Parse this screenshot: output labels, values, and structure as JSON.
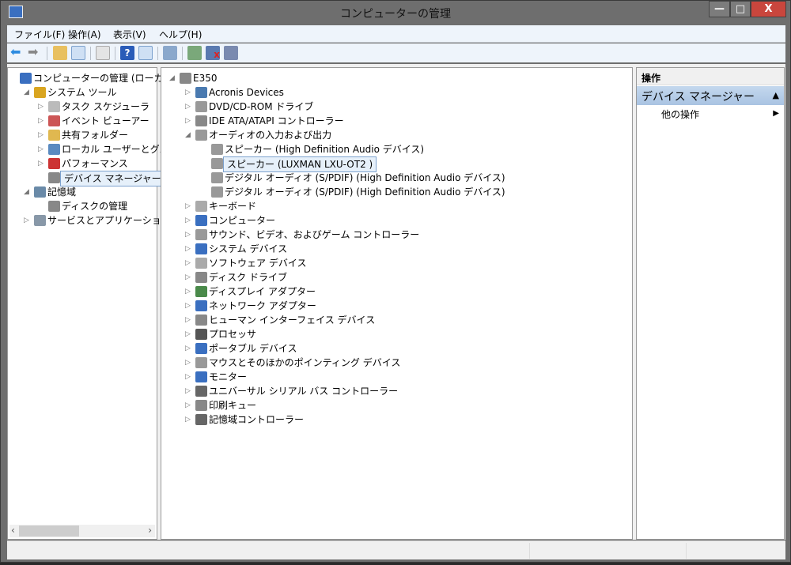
{
  "window": {
    "title": "コンピューターの管理",
    "min": "—",
    "max": "□",
    "close": "X"
  },
  "menu": [
    "ファイル(F)",
    "操作(A)",
    "表示(V)",
    "ヘルプ(H)"
  ],
  "left_tree": [
    {
      "label": "コンピューターの管理 (ローカル)",
      "level": 0,
      "exp": "",
      "color": "#3a6fc0"
    },
    {
      "label": "システム ツール",
      "level": 1,
      "exp": "◢",
      "color": "#d9a520"
    },
    {
      "label": "タスク スケジューラ",
      "level": 2,
      "exp": "▷",
      "color": "#bbb"
    },
    {
      "label": "イベント ビューアー",
      "level": 2,
      "exp": "▷",
      "color": "#c55"
    },
    {
      "label": "共有フォルダー",
      "level": 2,
      "exp": "▷",
      "color": "#e0b850"
    },
    {
      "label": "ローカル ユーザーとグループ",
      "level": 2,
      "exp": "▷",
      "color": "#5a8ac0"
    },
    {
      "label": "パフォーマンス",
      "level": 2,
      "exp": "▷",
      "color": "#c33"
    },
    {
      "label": "デバイス マネージャー",
      "level": 2,
      "exp": "",
      "color": "#888",
      "selected": true
    },
    {
      "label": "記憶域",
      "level": 1,
      "exp": "◢",
      "color": "#6a8aa8"
    },
    {
      "label": "ディスクの管理",
      "level": 2,
      "exp": "",
      "color": "#888"
    },
    {
      "label": "サービスとアプリケーション",
      "level": 1,
      "exp": "▷",
      "color": "#8898a8"
    }
  ],
  "device_tree": [
    {
      "label": "E350",
      "level": 0,
      "exp": "◢",
      "color": "#888"
    },
    {
      "label": "Acronis Devices",
      "level": 1,
      "exp": "▷",
      "color": "#4a7ab0"
    },
    {
      "label": "DVD/CD-ROM ドライブ",
      "level": 1,
      "exp": "▷",
      "color": "#999"
    },
    {
      "label": "IDE ATA/ATAPI コントローラー",
      "level": 1,
      "exp": "▷",
      "color": "#888"
    },
    {
      "label": "オーディオの入力および出力",
      "level": 1,
      "exp": "◢",
      "color": "#999"
    },
    {
      "label": "スピーカー (High Definition Audio デバイス)",
      "level": 2,
      "exp": "",
      "color": "#999"
    },
    {
      "label": "スピーカー (LUXMAN LXU-OT2  )",
      "level": 2,
      "exp": "",
      "color": "#999",
      "selected": true
    },
    {
      "label": "デジタル オーディオ (S/PDIF) (High Definition Audio デバイス)",
      "level": 2,
      "exp": "",
      "color": "#999"
    },
    {
      "label": "デジタル オーディオ (S/PDIF) (High Definition Audio デバイス)",
      "level": 2,
      "exp": "",
      "color": "#999"
    },
    {
      "label": "キーボード",
      "level": 1,
      "exp": "▷",
      "color": "#aaa"
    },
    {
      "label": "コンピューター",
      "level": 1,
      "exp": "▷",
      "color": "#3a6fc0"
    },
    {
      "label": "サウンド、ビデオ、およびゲーム コントローラー",
      "level": 1,
      "exp": "▷",
      "color": "#999"
    },
    {
      "label": "システム デバイス",
      "level": 1,
      "exp": "▷",
      "color": "#3a6fc0"
    },
    {
      "label": "ソフトウェア デバイス",
      "level": 1,
      "exp": "▷",
      "color": "#aaa"
    },
    {
      "label": "ディスク ドライブ",
      "level": 1,
      "exp": "▷",
      "color": "#888"
    },
    {
      "label": "ディスプレイ アダプター",
      "level": 1,
      "exp": "▷",
      "color": "#4a8a4a"
    },
    {
      "label": "ネットワーク アダプター",
      "level": 1,
      "exp": "▷",
      "color": "#3a6fc0"
    },
    {
      "label": "ヒューマン インターフェイス デバイス",
      "level": 1,
      "exp": "▷",
      "color": "#888"
    },
    {
      "label": "プロセッサ",
      "level": 1,
      "exp": "▷",
      "color": "#555"
    },
    {
      "label": "ポータブル デバイス",
      "level": 1,
      "exp": "▷",
      "color": "#3a6fc0"
    },
    {
      "label": "マウスとそのほかのポインティング デバイス",
      "level": 1,
      "exp": "▷",
      "color": "#999"
    },
    {
      "label": "モニター",
      "level": 1,
      "exp": "▷",
      "color": "#3a6fc0"
    },
    {
      "label": "ユニバーサル シリアル バス コントローラー",
      "level": 1,
      "exp": "▷",
      "color": "#666"
    },
    {
      "label": "印刷キュー",
      "level": 1,
      "exp": "▷",
      "color": "#888"
    },
    {
      "label": "記憶域コントローラー",
      "level": 1,
      "exp": "▷",
      "color": "#666"
    }
  ],
  "actions": {
    "header": "操作",
    "section": "デバイス マネージャー",
    "section_arrow": "▲",
    "item": "他の操作",
    "item_arrow": "▶"
  },
  "scroll": {
    "left": "‹",
    "right": "›"
  }
}
